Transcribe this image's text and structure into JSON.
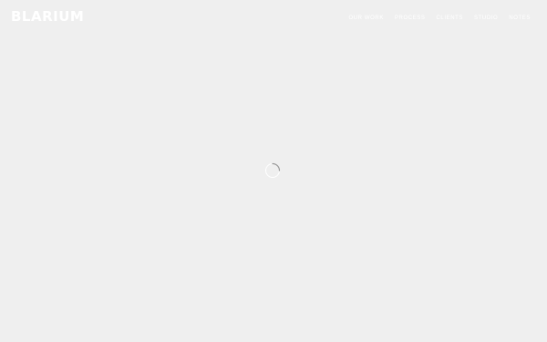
{
  "header": {
    "logo": "BLARIUM",
    "nav": [
      {
        "label": "Our Work"
      },
      {
        "label": "Process"
      },
      {
        "label": "Clients"
      },
      {
        "label": "Studio"
      },
      {
        "label": "Notes"
      }
    ]
  },
  "main": {
    "loader_icon": "loading-spinner-icon"
  },
  "colors": {
    "background": "#efefef",
    "foreground": "#ffffff",
    "spinner": "#9a9a9a"
  }
}
